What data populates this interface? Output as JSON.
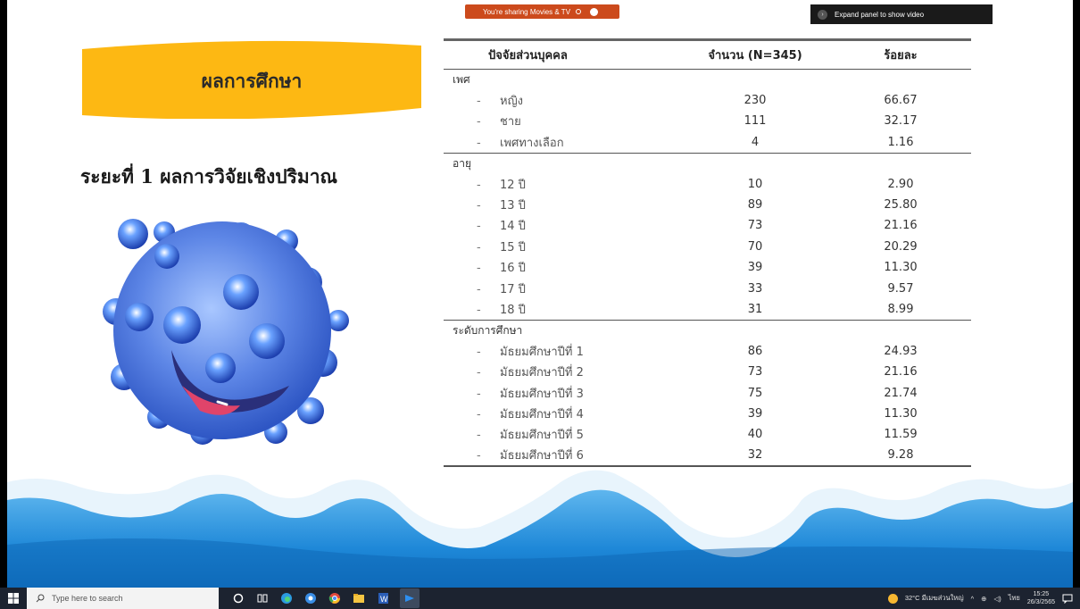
{
  "overlay": {
    "sharing_text": "You're sharing Movies & TV",
    "expand_panel_text": "Expand panel to show video",
    "window_controls": [
      "–",
      "▢",
      "✕"
    ]
  },
  "slide": {
    "title": "ผลการศึกษา",
    "subtitle": "ระยะที่ 1 ผลการวิจัยเชิงปริมาณ",
    "colors": {
      "banner": "#fdb813",
      "wave_blue": "#1e88d8",
      "mascot_blue": "#3f6fd8"
    }
  },
  "table": {
    "headers": [
      "ปัจจัยส่วนบุคคล",
      "จำนวน (N=345)",
      "ร้อยละ"
    ],
    "groups": [
      {
        "label": "เพศ",
        "rows": [
          {
            "label": "หญิง",
            "count": "230",
            "percent": "66.67"
          },
          {
            "label": "ชาย",
            "count": "111",
            "percent": "32.17"
          },
          {
            "label": "เพศทางเลือก",
            "count": "4",
            "percent": "1.16"
          }
        ]
      },
      {
        "label": "อายุ",
        "rows": [
          {
            "label": "12 ปี",
            "count": "10",
            "percent": "2.90"
          },
          {
            "label": "13 ปี",
            "count": "89",
            "percent": "25.80"
          },
          {
            "label": "14 ปี",
            "count": "73",
            "percent": "21.16"
          },
          {
            "label": "15 ปี",
            "count": "70",
            "percent": "20.29"
          },
          {
            "label": "16 ปี",
            "count": "39",
            "percent": "11.30"
          },
          {
            "label": "17 ปี",
            "count": "33",
            "percent": "9.57"
          },
          {
            "label": "18 ปี",
            "count": "31",
            "percent": "8.99"
          }
        ]
      },
      {
        "label": "ระดับการศึกษา",
        "rows": [
          {
            "label": "มัธยมศึกษาปีที่ 1",
            "count": "86",
            "percent": "24.93"
          },
          {
            "label": "มัธยมศึกษาปีที่ 2",
            "count": "73",
            "percent": "21.16"
          },
          {
            "label": "มัธยมศึกษาปีที่ 3",
            "count": "75",
            "percent": "21.74"
          },
          {
            "label": "มัธยมศึกษาปีที่ 4",
            "count": "39",
            "percent": "11.30"
          },
          {
            "label": "มัธยมศึกษาปีที่ 5",
            "count": "40",
            "percent": "11.59"
          },
          {
            "label": "มัธยมศึกษาปีที่ 6",
            "count": "32",
            "percent": "9.28"
          }
        ]
      }
    ]
  },
  "taskbar": {
    "search_placeholder": "Type here to search",
    "icons": [
      "cortana-icon",
      "task-view-icon",
      "edge-icon",
      "edge-dev-icon",
      "chrome-icon",
      "file-explorer-icon",
      "word-icon",
      "movies-tv-icon"
    ],
    "weather": "32°C มีเมฆส่วนใหญ่",
    "language": "ไทย",
    "time": "15:25",
    "date": "26/3/2565"
  }
}
